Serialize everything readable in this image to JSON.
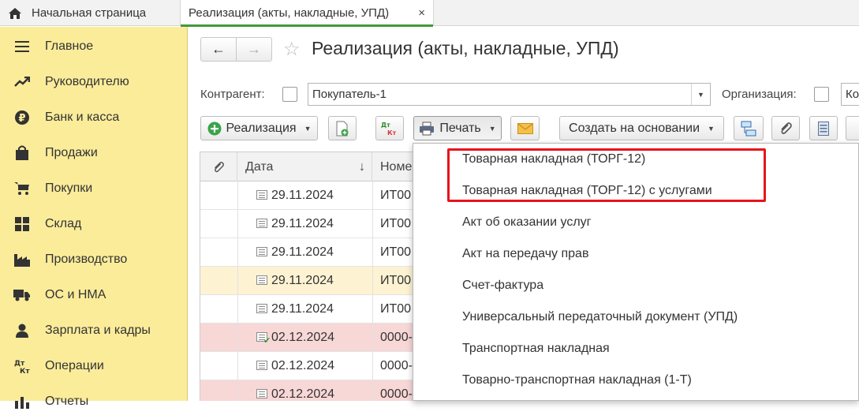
{
  "tabs": {
    "home_label": "Начальная страница",
    "active_label": "Реализация (акты, накладные, УПД)",
    "close_symbol": "×"
  },
  "sidebar": {
    "items": [
      {
        "label": "Главное",
        "icon": "menu-icon"
      },
      {
        "label": "Руководителю",
        "icon": "trend-icon"
      },
      {
        "label": "Банк и касса",
        "icon": "ruble-icon"
      },
      {
        "label": "Продажи",
        "icon": "shopping-bag-icon"
      },
      {
        "label": "Покупки",
        "icon": "cart-icon"
      },
      {
        "label": "Склад",
        "icon": "warehouse-icon"
      },
      {
        "label": "Производство",
        "icon": "factory-icon"
      },
      {
        "label": "ОС и НМА",
        "icon": "truck-icon"
      },
      {
        "label": "Зарплата и кадры",
        "icon": "person-icon"
      },
      {
        "label": "Операции",
        "icon": "dt-kt-icon"
      },
      {
        "label": "Отчеты",
        "icon": "bar-chart-icon"
      }
    ]
  },
  "header": {
    "title": "Реализация (акты, накладные, УПД)",
    "back_symbol": "←",
    "forward_symbol": "→",
    "star_symbol": "☆"
  },
  "filters": {
    "counterparty_label": "Контрагент:",
    "counterparty_value": "Покупатель-1",
    "organization_label": "Организация:",
    "organization_value": "Ко"
  },
  "toolbar": {
    "create_label": "Реализация",
    "dtkt_label_top": "Дт",
    "dtkt_label_bottom": "Кт",
    "print_label": "Печать",
    "create_based_label": "Создать на основании"
  },
  "table": {
    "columns": [
      "Дата",
      "Номе"
    ],
    "sort_symbol": "↓",
    "rows": [
      {
        "date": "29.11.2024",
        "number": "ИТ00",
        "status": "normal",
        "posted": false
      },
      {
        "date": "29.11.2024",
        "number": "ИТ00",
        "status": "normal",
        "posted": false
      },
      {
        "date": "29.11.2024",
        "number": "ИТ00",
        "status": "normal",
        "posted": false
      },
      {
        "date": "29.11.2024",
        "number": "ИТ00",
        "status": "selected",
        "posted": false
      },
      {
        "date": "29.11.2024",
        "number": "ИТ00",
        "status": "normal",
        "posted": false
      },
      {
        "date": "02.12.2024",
        "number": "0000-",
        "status": "red",
        "posted": true
      },
      {
        "date": "02.12.2024",
        "number": "0000-",
        "status": "normal",
        "posted": false
      },
      {
        "date": "02.12.2024",
        "number": "0000-",
        "status": "red",
        "posted": false
      }
    ]
  },
  "print_menu": {
    "items": [
      "Товарная накладная (ТОРГ-12)",
      "Товарная накладная (ТОРГ-12) с услугами",
      "Акт об оказании услуг",
      "Акт на передачу прав",
      "Счет-фактура",
      "Универсальный передаточный документ (УПД)",
      "Транспортная накладная",
      "Товарно-транспортная накладная (1-Т)"
    ],
    "highlight_color": "#e8141b"
  },
  "colors": {
    "sidebar_bg": "#fbec9a",
    "row_red": "#f8d7d7",
    "row_selected": "#fdf3d3",
    "active_tab_accent": "#3e9a3e"
  }
}
